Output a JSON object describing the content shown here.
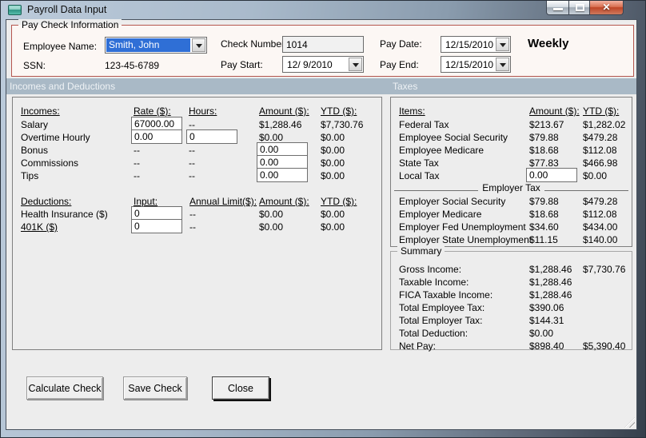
{
  "window": {
    "title": "Payroll Data Input"
  },
  "icons": {
    "close_glyph": "✕"
  },
  "paycheck": {
    "group_title": "Pay Check Information",
    "employee_name_label": "Employee Name:",
    "employee_name_value": "Smith, John",
    "ssn_label": "SSN:",
    "ssn_value": "123-45-6789",
    "check_number_label": "Check Number:",
    "check_number_value": "1014",
    "pay_start_label": "Pay Start:",
    "pay_start_value": "12/ 9/2010",
    "pay_date_label": "Pay Date:",
    "pay_date_value": "12/15/2010",
    "pay_end_label": "Pay End:",
    "pay_end_value": "12/15/2010",
    "pay_frequency": "Weekly"
  },
  "section_headers": {
    "left": "Incomes and Deductions",
    "right": "Taxes"
  },
  "incomes": {
    "columns": {
      "item": "Incomes:",
      "rate": "Rate ($):",
      "hours": "Hours:",
      "amount": "Amount ($):",
      "ytd": "YTD ($):"
    },
    "rows": [
      {
        "label": "Salary",
        "rate": "67000.00",
        "hours": "--",
        "amount": "$1,288.46",
        "ytd": "$7,730.76"
      },
      {
        "label": "Overtime Hourly",
        "rate": "0.00",
        "hours": "0",
        "amount": "$0.00",
        "ytd": "$0.00"
      },
      {
        "label": "Bonus",
        "rate": "--",
        "hours": "--",
        "amount": "0.00",
        "ytd": "$0.00"
      },
      {
        "label": "Commissions",
        "rate": "--",
        "hours": "--",
        "amount": "0.00",
        "ytd": "$0.00"
      },
      {
        "label": "Tips",
        "rate": "--",
        "hours": "--",
        "amount": "0.00",
        "ytd": "$0.00"
      }
    ]
  },
  "deductions": {
    "columns": {
      "item": "Deductions:",
      "input": "Input:",
      "limit": "Annual Limit($):",
      "amount": "Amount ($):",
      "ytd": "YTD ($):"
    },
    "rows": [
      {
        "label": "Health Insurance  ($)",
        "input": "0",
        "limit": "--",
        "amount": "$0.00",
        "ytd": "$0.00"
      },
      {
        "label": "401K  ($)",
        "input": "0",
        "limit": "--",
        "amount": "$0.00",
        "ytd": "$0.00"
      }
    ]
  },
  "taxes": {
    "columns": {
      "item": "Items:",
      "amount": "Amount ($):",
      "ytd": "YTD ($):"
    },
    "employee_rows": [
      {
        "label": "Federal Tax",
        "amount": "$213.67",
        "ytd": "$1,282.02"
      },
      {
        "label": "Employee Social Security",
        "amount": "$79.88",
        "ytd": "$479.28"
      },
      {
        "label": "Employee Medicare",
        "amount": "$18.68",
        "ytd": "$112.08"
      },
      {
        "label": "State Tax",
        "amount": "$77.83",
        "ytd": "$466.98"
      },
      {
        "label": "Local Tax",
        "amount": "0.00",
        "ytd": "$0.00"
      }
    ],
    "employer_section_title": "Employer Tax",
    "employer_rows": [
      {
        "label": "Employer Social Security",
        "amount": "$79.88",
        "ytd": "$479.28"
      },
      {
        "label": "Employer Medicare",
        "amount": "$18.68",
        "ytd": "$112.08"
      },
      {
        "label": "Employer Fed Unemployment",
        "amount": "$34.60",
        "ytd": "$434.00"
      },
      {
        "label": "Employer State Unemployment",
        "amount": "$11.15",
        "ytd": "$140.00"
      }
    ]
  },
  "summary": {
    "group_title": "Summary",
    "rows": [
      {
        "label": "Gross Income:",
        "amount": "$1,288.46",
        "ytd": "$7,730.76"
      },
      {
        "label": "Taxable Income:",
        "amount": "$1,288.46",
        "ytd": ""
      },
      {
        "label": "FICA Taxable Income:",
        "amount": "$1,288.46",
        "ytd": ""
      },
      {
        "label": "Total Employee Tax:",
        "amount": "$390.06",
        "ytd": ""
      },
      {
        "label": "Total Employer Tax:",
        "amount": "$144.31",
        "ytd": ""
      },
      {
        "label": "Total Deduction:",
        "amount": "$0.00",
        "ytd": ""
      },
      {
        "label": "Net Pay:",
        "amount": "$898.40",
        "ytd": "$5,390.40"
      }
    ]
  },
  "buttons": {
    "calculate": "Calculate Check",
    "save": "Save Check",
    "close": "Close"
  }
}
